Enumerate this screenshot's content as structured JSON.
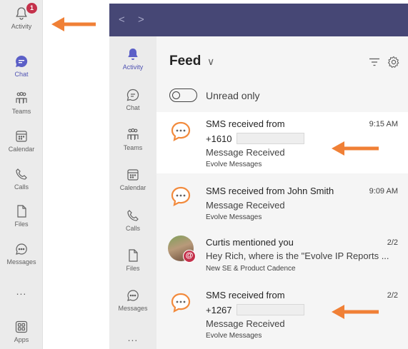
{
  "rail_primary": {
    "items": [
      {
        "label": "Activity",
        "icon": "bell-icon",
        "badge": "1"
      },
      {
        "label": "Chat",
        "icon": "chat-icon"
      },
      {
        "label": "Teams",
        "icon": "teams-icon"
      },
      {
        "label": "Calendar",
        "icon": "calendar-icon"
      },
      {
        "label": "Calls",
        "icon": "phone-icon"
      },
      {
        "label": "Files",
        "icon": "file-icon"
      },
      {
        "label": "Messages",
        "icon": "message-icon"
      },
      {
        "label": "Apps",
        "icon": "apps-icon"
      }
    ],
    "more": "..."
  },
  "topbar": {
    "back": "<",
    "forward": ">"
  },
  "rail_secondary": {
    "items": [
      {
        "label": "Activity",
        "icon": "bell-icon"
      },
      {
        "label": "Chat",
        "icon": "chat-icon"
      },
      {
        "label": "Teams",
        "icon": "teams-icon"
      },
      {
        "label": "Calendar",
        "icon": "calendar-icon"
      },
      {
        "label": "Calls",
        "icon": "phone-icon"
      },
      {
        "label": "Files",
        "icon": "file-icon"
      },
      {
        "label": "Messages",
        "icon": "message-icon"
      }
    ],
    "more": "..."
  },
  "feed": {
    "title": "Feed",
    "chevron": "∨",
    "toggle_label": "Unread only",
    "items": [
      {
        "line1": "SMS received from",
        "line2": "+1610",
        "line3": "Message Received",
        "line4": "Evolve Messages",
        "time": "9:15 AM"
      },
      {
        "line1": "SMS received from John Smith",
        "line2": "Message Received",
        "line3": "Evolve Messages",
        "time": "9:09 AM"
      },
      {
        "line1": "Curtis mentioned you",
        "line2": "Hey Rich, where is the \"Evolve IP Reports ...",
        "line3": "New SE & Product Cadence",
        "time": "2/2"
      },
      {
        "line1": "SMS received from",
        "line2": "+1267",
        "line3": "Message Received",
        "line4": "Evolve Messages",
        "time": "2/2"
      }
    ]
  },
  "colors": {
    "accent": "#464775",
    "brand_purple": "#4f52b2",
    "arrow_orange": "#f08036",
    "badge_red": "#c4314b",
    "sms_orange": "#f28a3c"
  }
}
